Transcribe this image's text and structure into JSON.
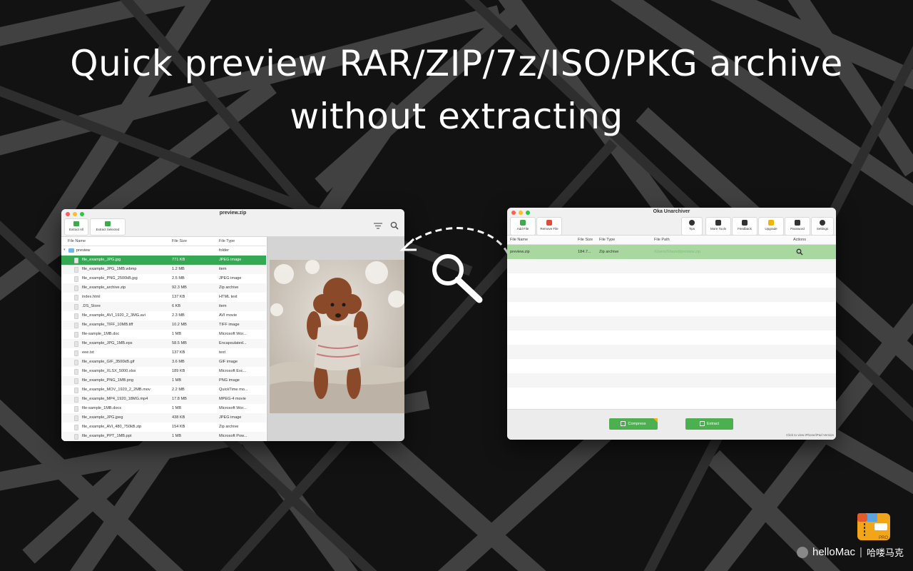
{
  "headline": {
    "line1": "Quick preview RAR/ZIP/7z/ISO/PKG archive",
    "line2": "without extracting"
  },
  "left_window": {
    "title": "preview.zip",
    "toolbar": {
      "extract_all": "Extract All",
      "extract_selected": "Extract Selected"
    },
    "columns": {
      "name": "File Name",
      "size": "File Size",
      "type": "File Type"
    },
    "folder": {
      "name": "preview",
      "type": "folder"
    },
    "rows": [
      {
        "name": "file_example_JPG.jpg",
        "size": "771 KB",
        "type": "JPEG image",
        "selected": true
      },
      {
        "name": "file_example_JPG_1MB.wbmp",
        "size": "1.2 MB",
        "type": "item"
      },
      {
        "name": "file_example_PNG_2500kB.jpg",
        "size": "2.5 MB",
        "type": "JPEG image"
      },
      {
        "name": "file_example_archive.zip",
        "size": "92.3 MB",
        "type": "Zip archive"
      },
      {
        "name": "index.html",
        "size": "137 KB",
        "type": "HTML text"
      },
      {
        "name": ".DS_Store",
        "size": "6 KB",
        "type": "item"
      },
      {
        "name": "file_example_AVI_1920_2_3MG.avi",
        "size": "2.3 MB",
        "type": "AVI movie"
      },
      {
        "name": "file_example_TIFF_10MB.tiff",
        "size": "10.2 MB",
        "type": "TIFF image"
      },
      {
        "name": "file-sample_1MB.doc",
        "size": "1 MB",
        "type": "Microsoft Wor..."
      },
      {
        "name": "file_example_JPG_1MB.eps",
        "size": "58.5 MB",
        "type": "Encapsulated..."
      },
      {
        "name": "eee.txt",
        "size": "137 KB",
        "type": "text"
      },
      {
        "name": "file_example_GIF_3500kB.gif",
        "size": "3.6 MB",
        "type": "GIF image"
      },
      {
        "name": "file_example_XLSX_5000.xlsx",
        "size": "189 KB",
        "type": "Microsoft Exc..."
      },
      {
        "name": "file_example_PNG_1MB.png",
        "size": "1 MB",
        "type": "PNG image"
      },
      {
        "name": "file_example_MOV_1920_2_2MB.mov",
        "size": "2.2 MB",
        "type": "QuickTime mo..."
      },
      {
        "name": "file_example_MP4_1920_18MG.mp4",
        "size": "17.8 MB",
        "type": "MPEG-4 movie"
      },
      {
        "name": "file-sample_1MB.docx",
        "size": "1 MB",
        "type": "Microsoft Wor..."
      },
      {
        "name": "file_example_JPG.jpeg",
        "size": "438 KB",
        "type": "JPEG image"
      },
      {
        "name": "file_example_AVI_480_750kB.zip",
        "size": "154 KB",
        "type": "Zip archive"
      },
      {
        "name": "file_example_PPT_1MB.ppt",
        "size": "1 MB",
        "type": "Microsoft Pow..."
      }
    ]
  },
  "right_window": {
    "title": "Oka Unarchiver",
    "toolbar_left": {
      "add_file": "Add File",
      "remove_file": "Remove File"
    },
    "toolbar_right": [
      "Tips",
      "More Tools",
      "Feedback",
      "Upgrade",
      "Password",
      "Settings"
    ],
    "columns": {
      "name": "File Name",
      "size": "File Size",
      "type": "File Type",
      "path": "File Path",
      "actions": "Actions"
    },
    "row": {
      "name": "preview.zip",
      "size": "184.7...",
      "type": "Zip archive",
      "path": "/Users/Shared/preview.zip"
    },
    "compress": "Compress",
    "extract": "Extract",
    "ipad_link": "Click to view iPhone/iPad Version"
  },
  "brand": {
    "name": "helloMac",
    "cn": "哈喽马克",
    "badge": "PRO"
  },
  "colors": {
    "accent_green": "#34a853",
    "button_green": "#4caf50",
    "row_green": "#a8d8a0"
  }
}
